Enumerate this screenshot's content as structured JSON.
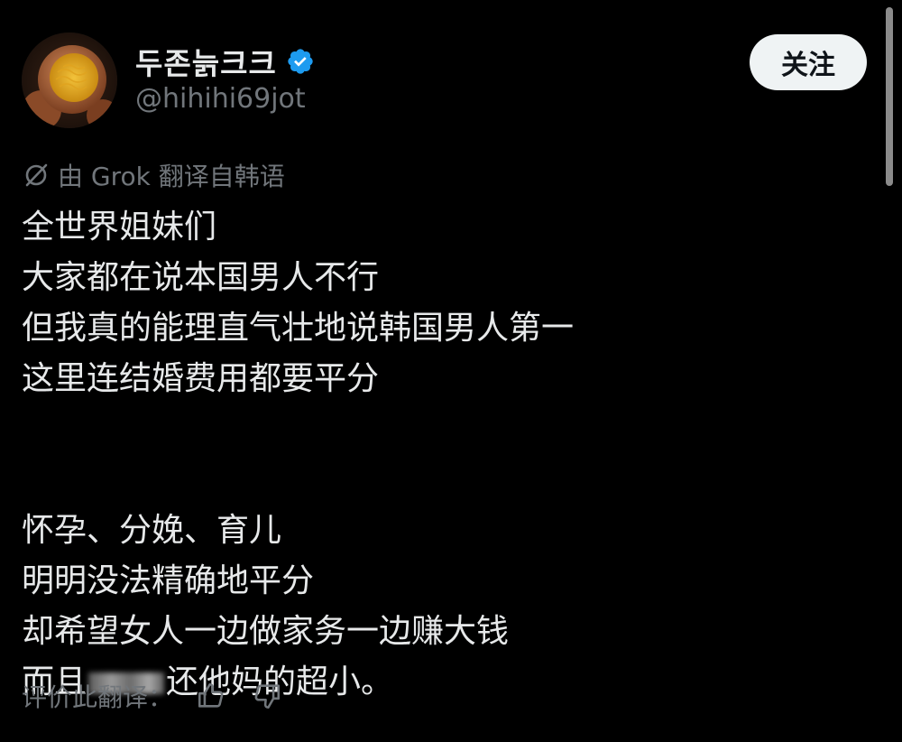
{
  "user": {
    "display_name": "두존늙크크",
    "handle": "@hihihi69jot",
    "verified": true
  },
  "follow_button": {
    "label": "关注"
  },
  "translation": {
    "note": "由 Grok 翻译自韩语"
  },
  "post": {
    "lines": [
      "全世界姐妹们",
      "大家都在说本国男人不行",
      "但我真的能理直气壮地说韩国男人第一",
      "这里连结婚费用都要平分",
      "怀孕、分娩、育儿",
      "明明没法精确地平分",
      "却希望女人一边做家务一边赚大钱",
      "而且",
      "还他妈的超小。"
    ]
  },
  "rate_translation": {
    "label": "评价此翻译："
  },
  "icons": {
    "verified": "verified-badge-icon",
    "translate": "translate-icon",
    "thumbs_up": "thumbs-up-icon",
    "thumbs_down": "thumbs-down-icon"
  },
  "colors": {
    "background": "#000000",
    "text": "#e7e9ea",
    "secondary": "#71767b",
    "verified": "#1d9bf0",
    "button_bg": "#eff3f4"
  }
}
